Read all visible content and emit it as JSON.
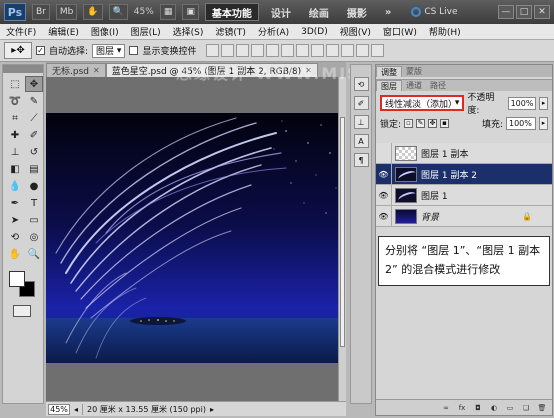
{
  "app": {
    "logo": "Ps",
    "zoom_display": "45%",
    "workspaces": [
      "基本功能",
      "设计",
      "绘画",
      "摄影"
    ],
    "active_workspace": "基本功能",
    "overflow": "»",
    "cs_live": "CS Live",
    "window_buttons": [
      "—",
      "□",
      "✕"
    ]
  },
  "menu": [
    "文件(F)",
    "编辑(E)",
    "图像(I)",
    "图层(L)",
    "选择(S)",
    "滤镜(T)",
    "分析(A)",
    "3D(D)",
    "视图(V)",
    "窗口(W)",
    "帮助(H)"
  ],
  "options": {
    "auto_select_label": "自动选择:",
    "auto_select_value": "图层",
    "show_transform_label": "显示变换控件"
  },
  "document": {
    "tabs": [
      {
        "label": "无标.psd",
        "active": false
      },
      {
        "label": "蓝色星空.psd @ 45% (图层 1 副本 2, RGB/8)",
        "active": true
      }
    ],
    "watermark": "思缘设计 WWW.MISSYUAN.COM",
    "status_zoom": "45%",
    "status_info": "20 厘米 x 13.55 厘米 (150 ppi)"
  },
  "panel": {
    "top_tabs": [
      "调整",
      "蒙版"
    ],
    "tabs": [
      "图层",
      "通道",
      "路径"
    ],
    "blend_mode": "线性减淡（添加）",
    "opacity_label": "不透明度:",
    "opacity_value": "100%",
    "lock_label": "锁定:",
    "fill_label": "填充:",
    "fill_value": "100%",
    "layers": [
      {
        "name": "图层 1 副本",
        "visible": false,
        "selected": false,
        "thumb": "transparent"
      },
      {
        "name": "图层 1 副本 2",
        "visible": true,
        "selected": true,
        "thumb": "swirl"
      },
      {
        "name": "图层 1",
        "visible": true,
        "selected": false,
        "thumb": "swirl"
      },
      {
        "name": "背景",
        "visible": true,
        "selected": false,
        "thumb": "bg",
        "locked": true
      }
    ]
  },
  "annotation": {
    "text": "分别将 “图层 1”、“图层 1 副本 2” 的混合模式进行修改"
  },
  "colors": {
    "selected_layer": "#1b2f6b",
    "highlight_box": "#e02a1f"
  }
}
